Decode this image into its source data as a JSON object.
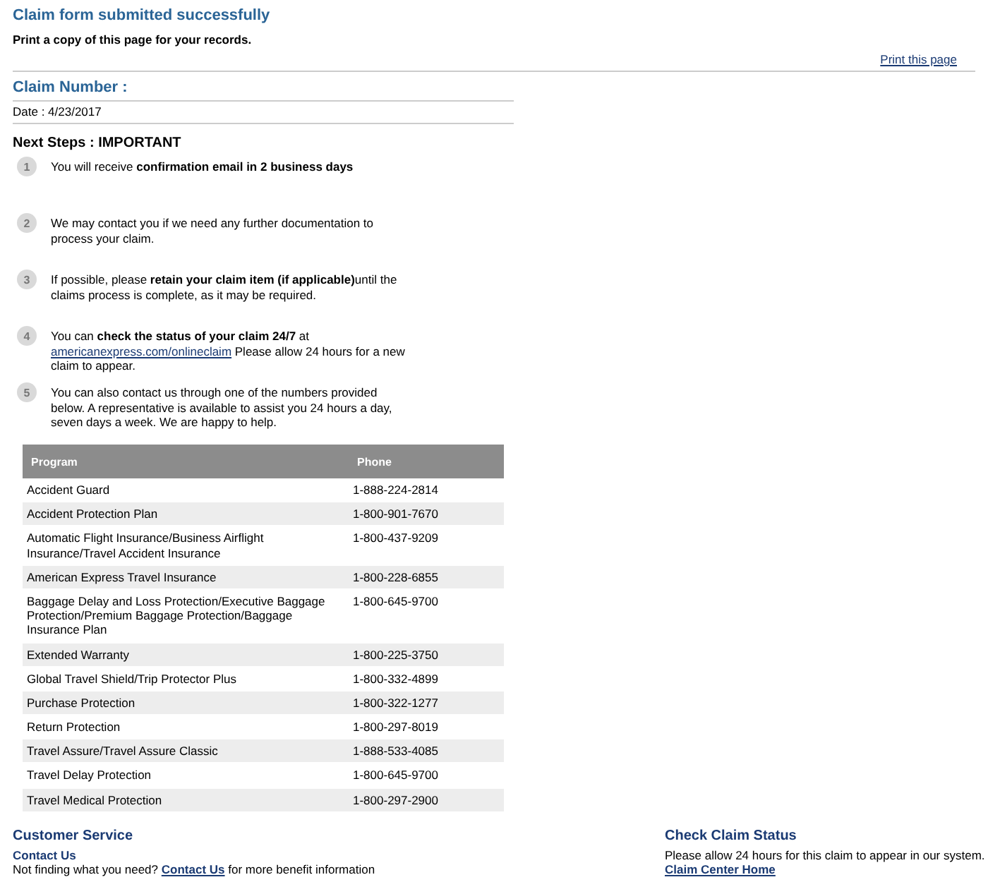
{
  "header": {
    "title": "Claim form submitted successfully",
    "subtitle": "Print a copy of this page for your records.",
    "print_link": "Print this page"
  },
  "claim": {
    "number_label": "Claim Number :",
    "date": "Date : 4/23/2017"
  },
  "next_steps": {
    "title": "Next Steps : IMPORTANT",
    "steps": [
      {
        "number": "1",
        "text": "You will receive **confirmation email in 2 business days**"
      },
      {
        "number": "2",
        "text": "We may contact you if we need any further documentation to process your claim."
      },
      {
        "number": "3",
        "text": "If possible, please **retain your claim item (if applicable)**until the claims process is complete, as it may be required."
      },
      {
        "number": "4",
        "text": "You can **check the status of your claim 24/7** at",
        "link": "americanexpress.com/onlineclaim",
        "text_after": "Please allow 24 hours for a new claim to appear."
      },
      {
        "number": "5",
        "text": "You can also contact us through one of the numbers provided below. A representative is available to assist you 24 hours a day, seven days a week. We are happy to help."
      }
    ]
  },
  "table": {
    "columns": [
      "Program",
      "Phone"
    ],
    "rows": [
      [
        "Accident Guard",
        "1-888-224-2814"
      ],
      [
        "Accident Protection Plan",
        "1-800-901-7670"
      ],
      [
        "Automatic Flight Insurance/Business Airflight Insurance/Travel Accident Insurance",
        "1-800-437-9209"
      ],
      [
        "American Express Travel Insurance",
        "1-800-228-6855"
      ],
      [
        "Baggage Delay and Loss Protection/Executive Baggage Protection/Premium Baggage Protection/Baggage Insurance Plan",
        "1-800-645-9700"
      ],
      [
        "Extended Warranty",
        "1-800-225-3750"
      ],
      [
        "Global Travel Shield/Trip Protector Plus",
        "1-800-332-4899"
      ],
      [
        "Purchase Protection",
        "1-800-322-1277"
      ],
      [
        "Return Protection",
        "1-800-297-8019"
      ],
      [
        "Travel Assure/Travel Assure Classic",
        "1-888-533-4085"
      ],
      [
        "Travel Delay Protection",
        "1-800-645-9700"
      ],
      [
        "Travel Medical Protection",
        "1-800-297-2900"
      ]
    ]
  },
  "footer": {
    "customer_service": {
      "title": "Customer Service",
      "subtitle": "Contact Us",
      "text": "Not finding what you need?",
      "link": "Contact Us",
      "text_after": "for more benefit information"
    },
    "claim_status": {
      "title": "Check Claim Status",
      "text": "Please allow 24 hours for this claim to appear in our system.",
      "link": "Claim Center Home"
    }
  }
}
